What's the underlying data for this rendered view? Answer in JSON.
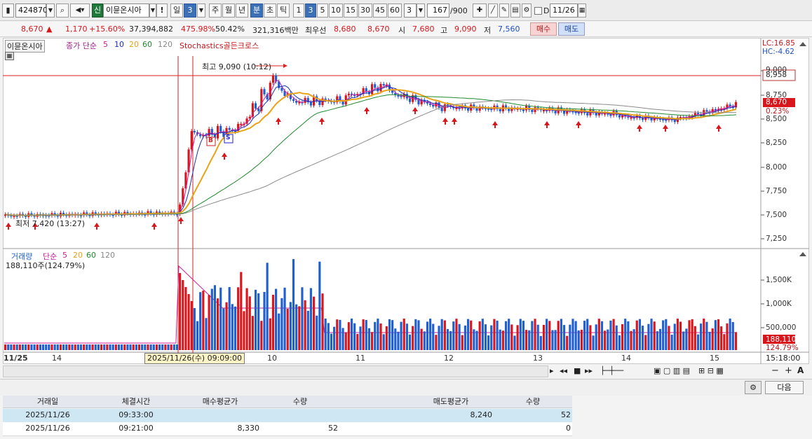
{
  "toolbar": {
    "code": "424870",
    "market_badge": "신",
    "stock_name": "이뮨온시아",
    "alert": "!",
    "periods": [
      "일",
      "3",
      "주",
      "월",
      "년",
      "분",
      "초",
      "틱"
    ],
    "minute_steps": [
      "1",
      "3",
      "5",
      "10",
      "15",
      "30",
      "45",
      "60"
    ],
    "interval_value": "3",
    "range_value": "167",
    "range_total": "/900",
    "date_checkbox_label": "D",
    "date_value": "11/26"
  },
  "info_bar": {
    "price": "8,670",
    "change_arrow": "▲",
    "change": "1,170",
    "change_rate": "+15.60%",
    "volume": "37,394,882",
    "volume_rate": "475.98%",
    "ratio": "50.42%",
    "amount": "321,316백만",
    "best_ask_label": "최우선",
    "best_ask": "8,680",
    "best_bid": "8,670",
    "open_label": "시",
    "open": "7,680",
    "high_label": "고",
    "high": "9,090",
    "low_label": "저",
    "low": "7,560",
    "buy_label": "매수",
    "sell_label": "매도"
  },
  "price_panel": {
    "stock_tag": "이뮨온시아",
    "ma_label": "종가 단순",
    "ma_periods": [
      "5",
      "10",
      "20",
      "60",
      "120"
    ],
    "indicator": "Stochastics골든크로스",
    "high_annotation": "최고 9,090 (10:12)",
    "low_annotation": "최저 7,420 (13:27)",
    "lc": "LC:16.85",
    "hc": "HC:-4.62",
    "marker_line_price": "8,958",
    "current_price_tag": "8,670",
    "current_rate_tag": "0.23%",
    "y_ticks": [
      "9,000",
      "8,750",
      "8,500",
      "8,250",
      "8,000",
      "7,750",
      "7,500",
      "7,250"
    ],
    "signal_b": "B",
    "signal_s": "S"
  },
  "volume_panel": {
    "title": "거래량",
    "ma_label": "단순",
    "ma_periods": [
      "5",
      "20",
      "60",
      "120"
    ],
    "current_info": "188,110주(124.79%)",
    "y_ticks": [
      "1,500K",
      "1,000K",
      "500,000"
    ],
    "current_tag": "188,110",
    "current_rate_tag": "124.79%"
  },
  "x_axis": {
    "labels": [
      "11/25",
      "14",
      "10",
      "11",
      "12",
      "13",
      "14",
      "15"
    ],
    "cursor_label": "2025/11/26(수) 09:09:00",
    "end_time": "15:18:00"
  },
  "bottom_toolbar": {
    "next_label": "다음"
  },
  "trade_table": {
    "headers": [
      "거래일",
      "체결시간",
      "매수평균가",
      "수량",
      "",
      "매도평균가",
      "수량"
    ],
    "rows": [
      [
        "2025/11/26",
        "09:33:00",
        "",
        "",
        "",
        "8,240",
        "52"
      ],
      [
        "2025/11/26",
        "09:21:00",
        "8,330",
        "52",
        "",
        "",
        "0"
      ]
    ]
  },
  "colors": {
    "up": "#d8161c",
    "down": "#1f5fd0",
    "ma5": "#d01f9a",
    "ma10": "#1a2fb8",
    "ma20": "#e8a316",
    "ma60": "#1f8a2e",
    "ma120": "#8a8a8a",
    "selected": "#3b6fb6"
  }
}
